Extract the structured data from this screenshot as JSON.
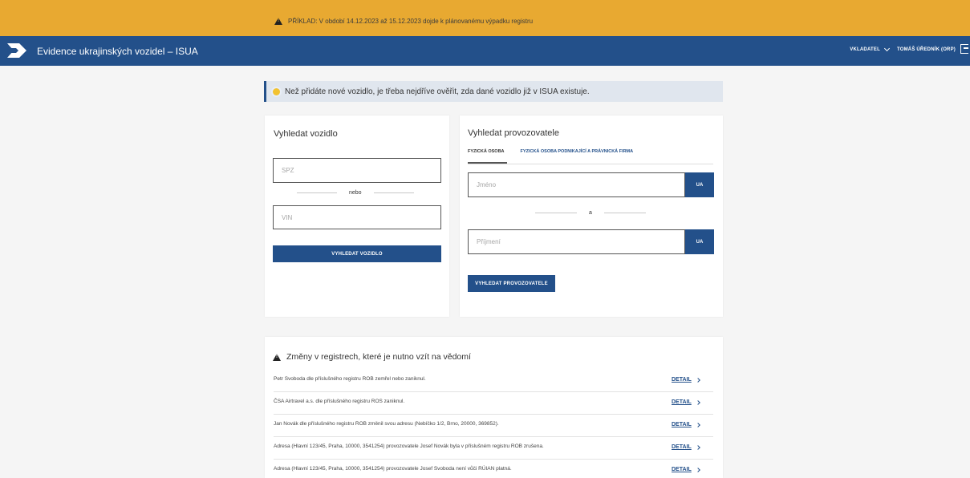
{
  "banner": {
    "text": "PŘÍKLAD: V období 14.12.2023 až 15.12.2023 dojde k plánovanému výpadku registru",
    "icon": "warning-icon"
  },
  "header": {
    "title": "Evidence ukrajinských vozidel – ISUA",
    "role": "VKLADATEL",
    "user": "TOMÁŠ ÚŘEDNÍK (ORP)",
    "logo_icon": "isua-logo-icon",
    "logout_icon": "logout-icon"
  },
  "info": {
    "text": "Než přidáte nové vozidlo, je třeba nejdříve ověřit, zda dané vozidlo již v ISUA existuje.",
    "icon": "lightbulb-icon"
  },
  "vehicle_search": {
    "title": "Vyhledat vozidlo",
    "spz_placeholder": "SPZ",
    "or_label": "nebo",
    "vin_placeholder": "VIN",
    "button_label": "VYHLEDAT VOZIDLO"
  },
  "operator_search": {
    "title": "Vyhledat provozovatele",
    "tabs": [
      {
        "label": "FYZICKÁ OSOBA",
        "active": true
      },
      {
        "label": "FYZICKÁ OSOBA PODNIKAJÍCÍ A PRÁVNICKÁ FIRMA",
        "active": false
      }
    ],
    "first_name_placeholder": "Jméno",
    "and_label": "a",
    "last_name_placeholder": "Příjmení",
    "ua_label": "UA",
    "button_label": "VYHLEDAT PROVOZOVATELE"
  },
  "changes": {
    "title": "Změny v registrech, které je nutno vzít na vědomí",
    "detail_label": "DETAIL",
    "rows": [
      {
        "text": "Petr Svoboda dle příslušného registru ROB zemřel nebo zaniknul."
      },
      {
        "text": "ČSA Airtravel a.s. dle příslušného registru ROS zaniknul."
      },
      {
        "text": "Jan Novák dle příslušného registru ROB změnil svou adresu (Nebíčko 1/2, Brno, 20000, 369852)."
      },
      {
        "text": "Adresa (Hlavní 123/45, Praha, 10000, 3541254) provozovatele Josef Novák byla v příslušném registru ROB zrušena."
      },
      {
        "text": "Adresa (Hlavní 123/45, Praha, 10000, 3541254) provozovatele Josef Svoboda není vůči RÚIAN platná."
      }
    ]
  },
  "colors": {
    "banner": "#e8a931",
    "primary": "#23508a",
    "info_bg": "#e0e6ee",
    "page_bg": "#f5f5f5"
  }
}
